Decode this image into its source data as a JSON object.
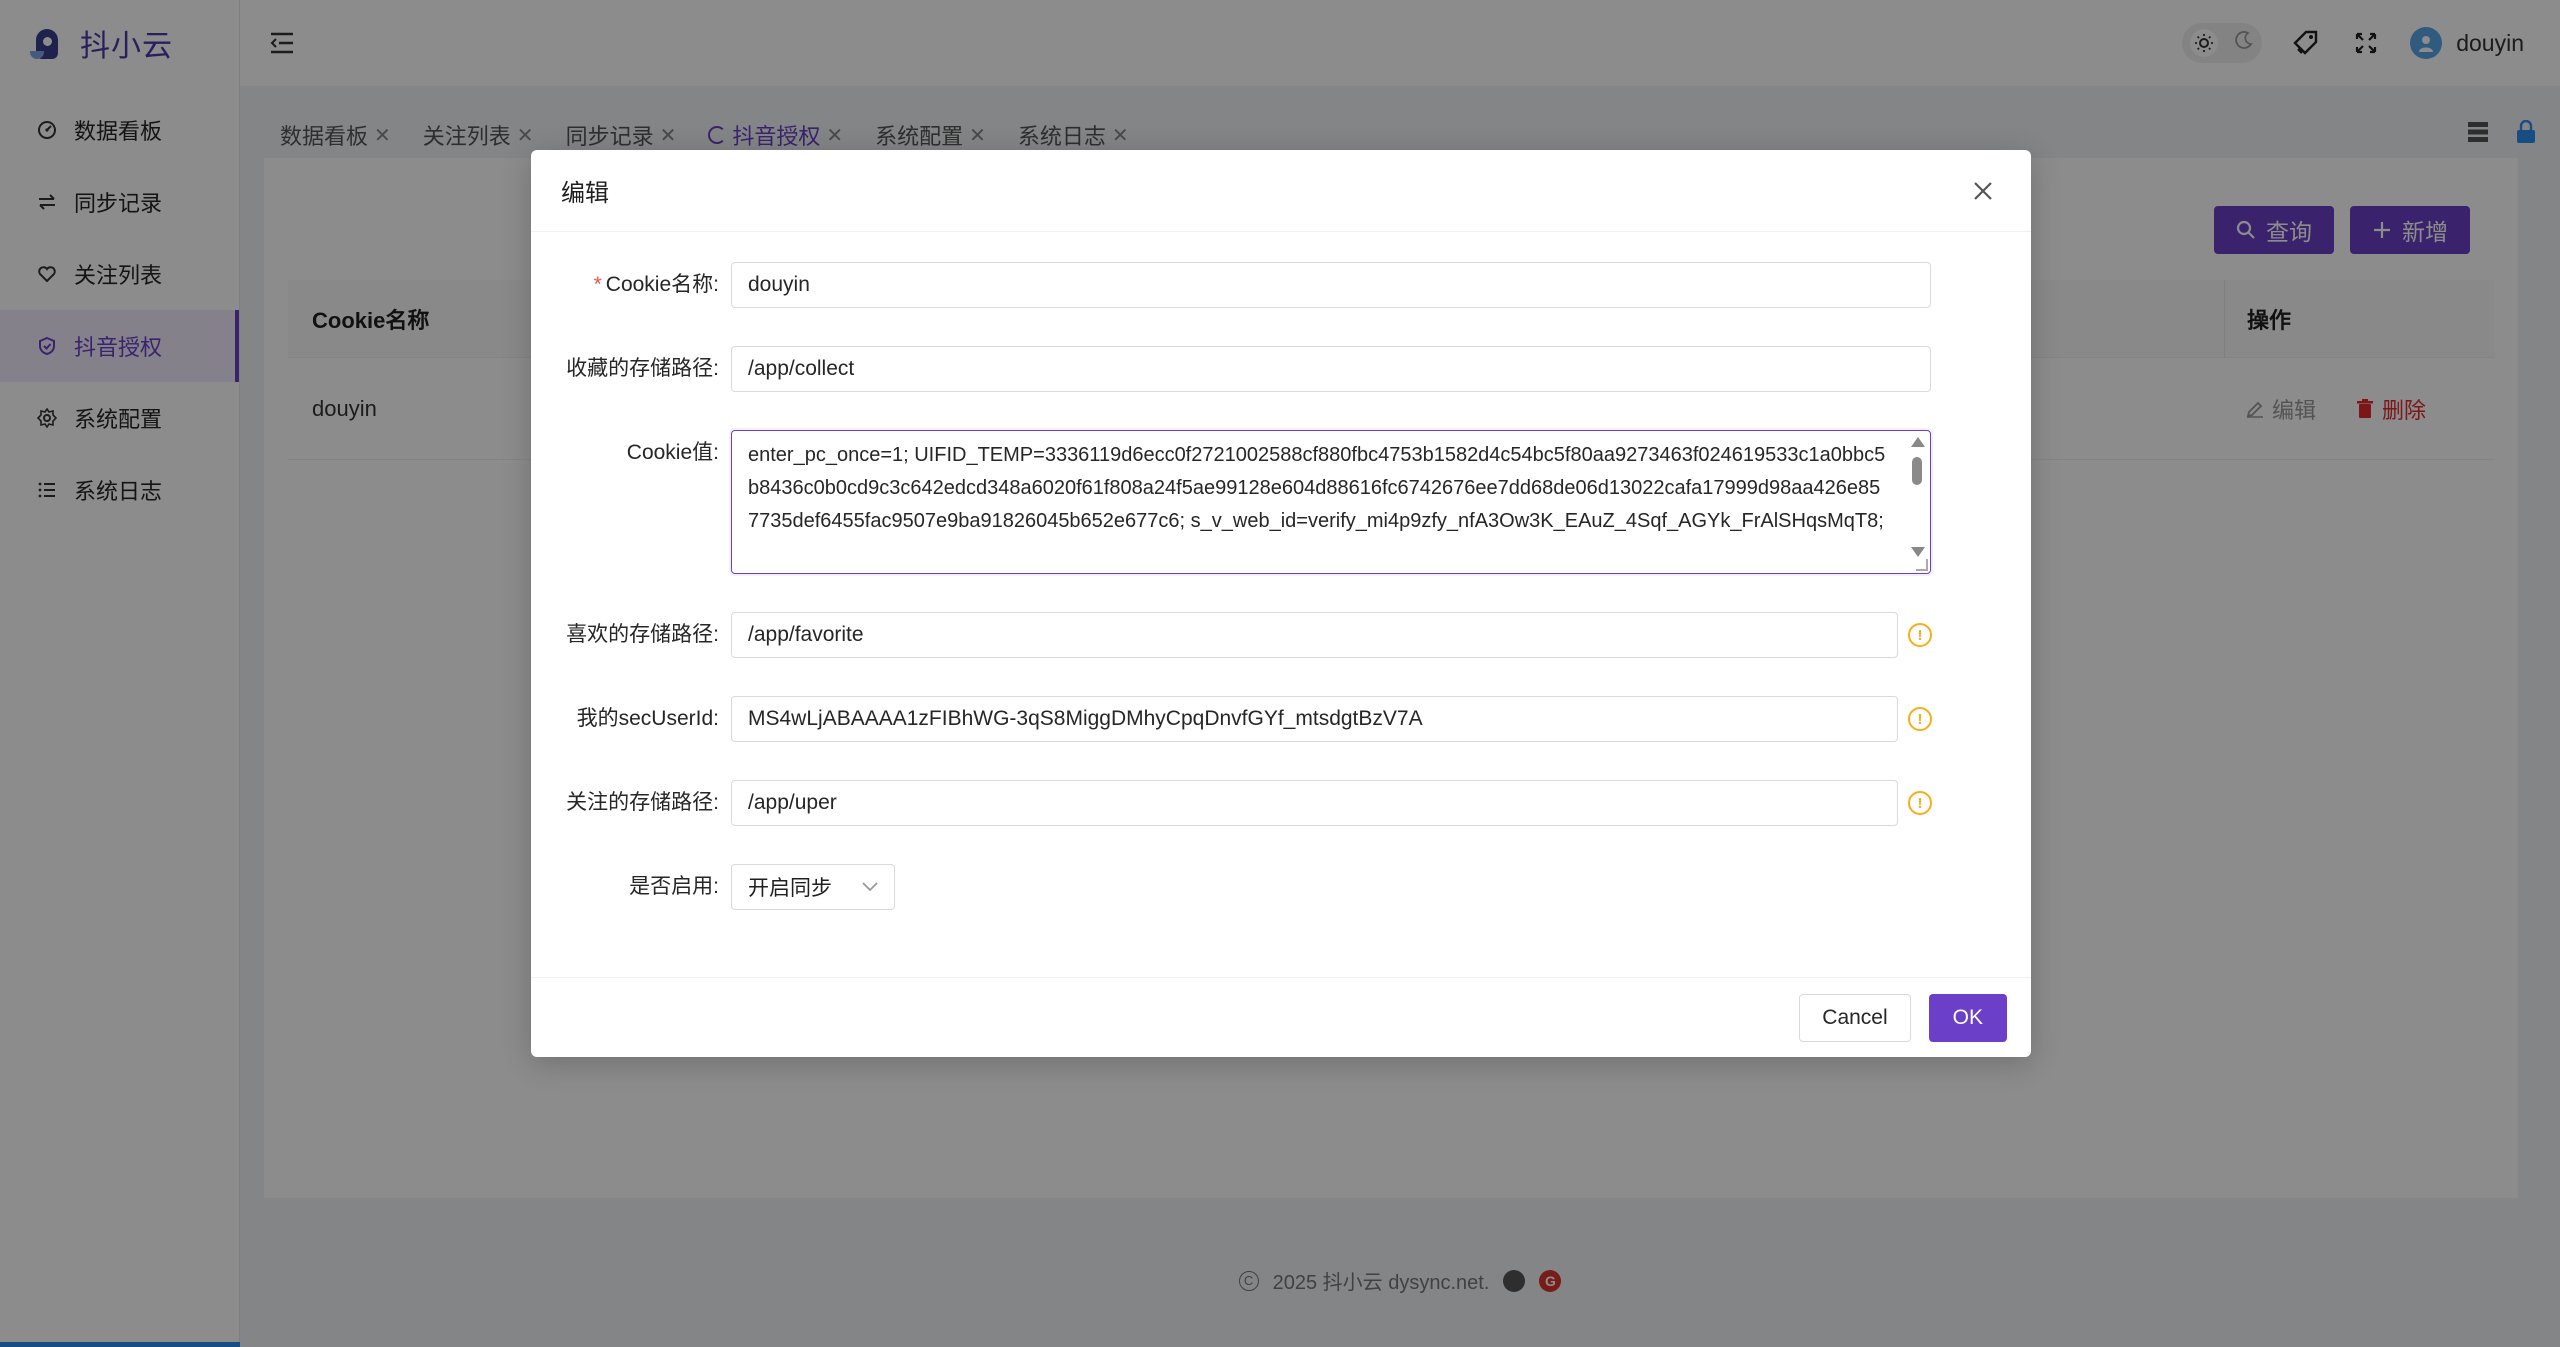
{
  "app": {
    "name": "抖小云"
  },
  "sidebar": {
    "items": [
      {
        "label": "数据看板",
        "icon": "dashboard-icon",
        "active": false
      },
      {
        "label": "同步记录",
        "icon": "sync-arrows-icon",
        "active": false
      },
      {
        "label": "关注列表",
        "icon": "heart-icon",
        "active": false
      },
      {
        "label": "抖音授权",
        "icon": "shield-check-icon",
        "active": true
      },
      {
        "label": "系统配置",
        "icon": "gear-icon",
        "active": false
      },
      {
        "label": "系统日志",
        "icon": "list-icon",
        "active": false
      }
    ]
  },
  "header": {
    "username": "douyin"
  },
  "tabs": [
    {
      "label": "数据看板",
      "active": false
    },
    {
      "label": "关注列表",
      "active": false
    },
    {
      "label": "同步记录",
      "active": false
    },
    {
      "label": "抖音授权",
      "active": true
    },
    {
      "label": "系统配置",
      "active": false
    },
    {
      "label": "系统日志",
      "active": false
    }
  ],
  "toolbar": {
    "query_label": "查询",
    "add_label": "新增"
  },
  "table": {
    "columns": {
      "name": "Cookie名称",
      "ops": "操作"
    },
    "rows": [
      {
        "name": "douyin",
        "edit": "编辑",
        "delete": "删除"
      }
    ]
  },
  "footer": {
    "text": "2025 抖小云 dysync.net."
  },
  "modal": {
    "title": "编辑",
    "fields": {
      "cookie_name": {
        "label": "Cookie名称",
        "value": "douyin"
      },
      "collect_path": {
        "label": "收藏的存储路径",
        "value": "/app/collect"
      },
      "cookie_value": {
        "label": "Cookie值",
        "value": "enter_pc_once=1; UIFID_TEMP=3336119d6ecc0f2721002588cf880fbc4753b1582d4c54bc5f80aa9273463f024619533c1a0bbc5b8436c0b0cd9c3c642edcd348a6020f61f808a24f5ae99128e604d88616fc6742676ee7dd68de06d13022cafa17999d98aa426e857735def6455fac9507e9ba91826045b652e677c6; s_v_web_id=verify_mi4p9zfy_nfA3Ow3K_EAuZ_4Sqf_AGYk_FrAlSHqsMqT8;"
      },
      "favorite_path": {
        "label": "喜欢的存储路径",
        "value": "/app/favorite"
      },
      "sec_user_id": {
        "label": "我的secUserId",
        "value": "MS4wLjABAAAA1zFIBhWG-3qS8MiggDMhyCpqDnvfGYf_mtsdgtBzV7A"
      },
      "uper_path": {
        "label": "关注的存储路径",
        "value": "/app/uper"
      },
      "enabled": {
        "label": "是否启用",
        "value": "开启同步"
      }
    },
    "cancel_label": "Cancel",
    "ok_label": "OK"
  },
  "colors": {
    "primary": "#6b3fc7",
    "danger": "#e0282e",
    "warning": "#faad14"
  }
}
